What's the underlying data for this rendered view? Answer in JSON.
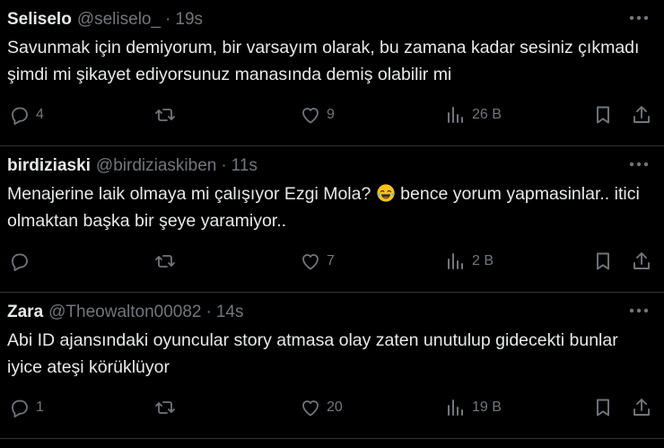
{
  "colors": {
    "background": "#000000",
    "text": "#e7e9ea",
    "muted": "#71767b",
    "divider": "#2f3336"
  },
  "tweets": [
    {
      "name": "Seliselo",
      "handle": "@seliselo_",
      "separator": "·",
      "time": "19s",
      "text": "Savunmak için demiyorum, bir varsayım olarak, bu zamana kadar sesiniz çıkmadı şimdi mi şikayet ediyorsunuz manasında demiş olabilir mi",
      "replies": "4",
      "retweets": "",
      "likes": "9",
      "views": "26 B"
    },
    {
      "name": "birdiziaski",
      "handle": "@birdiziaskiben",
      "separator": "·",
      "time": "11s",
      "text_before_emoji": "Menajerine laik olmaya mi çalışıyor Ezgi Mola?",
      "emoji": "face-with-tears-of-joy",
      "text_after_emoji": "bence yorum yapmasinlar.. itici olmaktan başka bir şeye yaramiyor..",
      "replies": "",
      "retweets": "",
      "likes": "7",
      "views": "2 B"
    },
    {
      "name": "Zara",
      "handle": "@Theowalton00082",
      "separator": "·",
      "time": "14s",
      "text": "Abi ID ajansındaki oyuncular story atmasa olay zaten unutulup gidecekti bunlar iyice ateşi körüklüyor",
      "replies": "1",
      "retweets": "",
      "likes": "20",
      "views": "19 B"
    }
  ]
}
